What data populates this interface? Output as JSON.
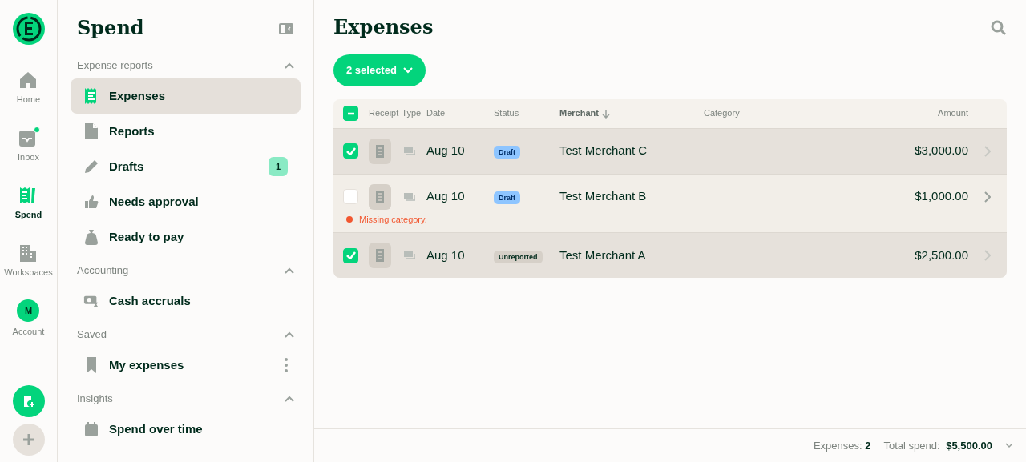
{
  "rail": {
    "items": [
      {
        "label": "Home",
        "kind": "home",
        "selected": false,
        "dot": false
      },
      {
        "label": "Inbox",
        "kind": "inbox",
        "selected": false,
        "dot": true
      },
      {
        "label": "Spend",
        "kind": "spend",
        "selected": true,
        "dot": false
      },
      {
        "label": "Workspaces",
        "kind": "building",
        "selected": false,
        "dot": false
      },
      {
        "label": "Account",
        "kind": "avatar",
        "avatar": "M",
        "selected": false,
        "dot": false
      }
    ]
  },
  "nav": {
    "title": "Spend",
    "sections": [
      {
        "title": "Expense reports",
        "expanded": true,
        "items": [
          {
            "label": "Expenses",
            "kind": "receipt",
            "selected": true
          },
          {
            "label": "Reports",
            "kind": "doc",
            "selected": false
          },
          {
            "label": "Drafts",
            "kind": "pencil",
            "selected": false,
            "badge": "1"
          },
          {
            "label": "Needs approval",
            "kind": "thumb",
            "selected": false
          },
          {
            "label": "Ready to pay",
            "kind": "bag",
            "selected": false
          }
        ]
      },
      {
        "title": "Accounting",
        "expanded": true,
        "items": [
          {
            "label": "Cash accruals",
            "kind": "cash",
            "selected": false
          }
        ]
      },
      {
        "title": "Saved",
        "expanded": true,
        "items": [
          {
            "label": "My expenses",
            "kind": "bookmark",
            "selected": false,
            "menu": true
          }
        ]
      },
      {
        "title": "Insights",
        "expanded": true,
        "items": [
          {
            "label": "Spend over time",
            "kind": "calendar",
            "selected": false
          }
        ]
      }
    ]
  },
  "main": {
    "title": "Expenses",
    "selection_button": "2 selected",
    "table": {
      "select_all": {
        "checked": true,
        "mixed": true
      },
      "columns": [
        {
          "label": "Receipt",
          "sorted": false
        },
        {
          "label": "Type",
          "sorted": false
        },
        {
          "label": "Date",
          "sorted": false
        },
        {
          "label": "Status",
          "sorted": false
        },
        {
          "label": "Merchant",
          "sorted": true
        },
        {
          "label": "Category",
          "sorted": false
        },
        {
          "label": "Amount",
          "sorted": false
        }
      ],
      "rows": [
        {
          "selected": true,
          "date": "Aug 10",
          "status": "Draft",
          "kind": "draft",
          "merchant": "Test Merchant C",
          "amount": "$3,000.00"
        },
        {
          "selected": false,
          "date": "Aug 10",
          "status": "Draft",
          "kind": "draft",
          "merchant": "Test Merchant B",
          "amount": "$1,000.00",
          "warning": "Missing category."
        },
        {
          "selected": true,
          "date": "Aug 10",
          "status": "Unreported",
          "kind": "unreported",
          "merchant": "Test Merchant A",
          "amount": "$2,500.00"
        }
      ]
    }
  },
  "footer": {
    "expenses_label": "Expenses:",
    "expenses_count": "2",
    "total_label": "Total spend:",
    "total": "$5,500.00"
  }
}
